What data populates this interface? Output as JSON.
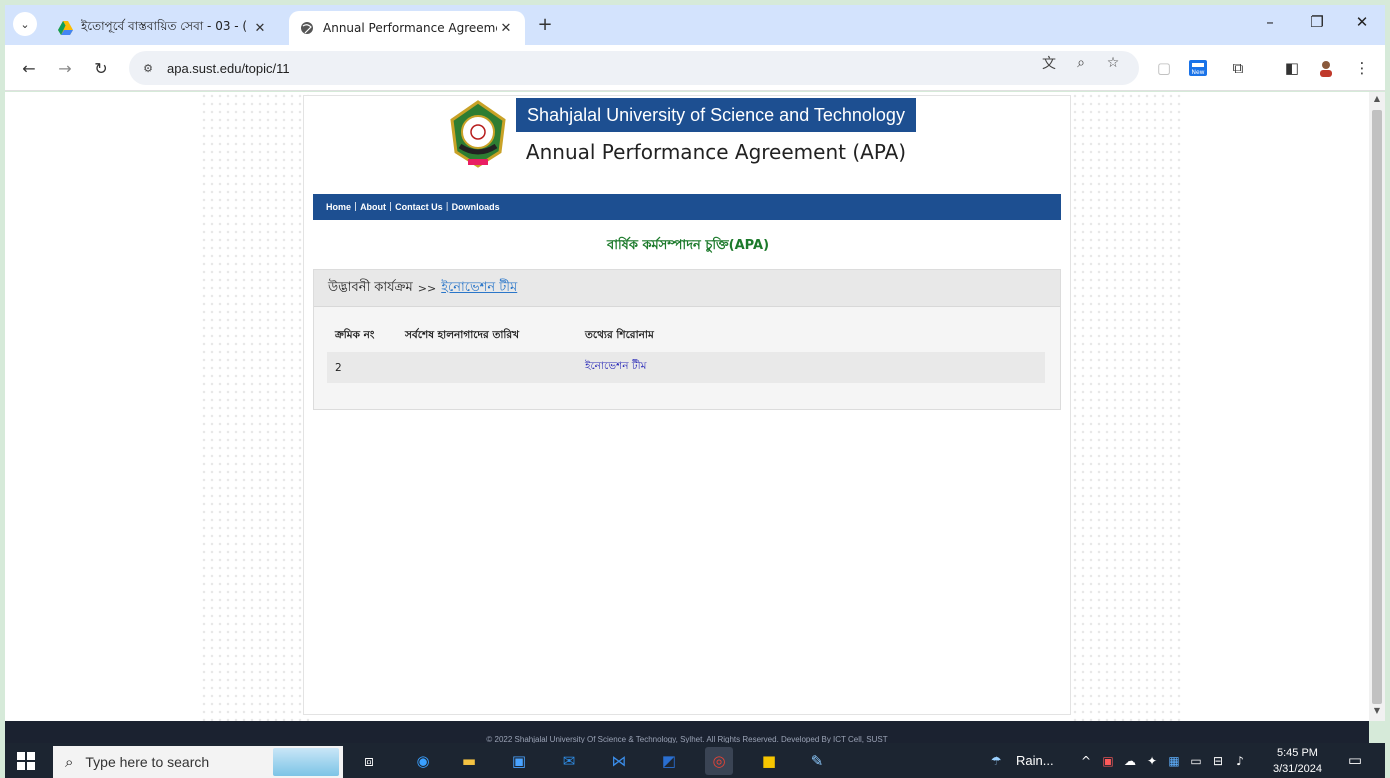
{
  "browser": {
    "tabs": [
      {
        "title": "ইতোপূর্বে বাস্তবায়িত সেবা - 03 - (",
        "active": false
      },
      {
        "title": "Annual Performance Agreemen",
        "active": true
      }
    ],
    "url": "apa.sust.edu/topic/11"
  },
  "site": {
    "university": "Shahjalal University of Science and Technology",
    "title": "Annual Performance Agreement (APA)",
    "nav": [
      "Home",
      "About",
      "Contact Us",
      "Downloads"
    ],
    "section_title": "বার্ষিক কর্মসম্পাদন চুক্তি(APA)"
  },
  "panel": {
    "crumb": "উদ্ভাবনী কার্যক্রম",
    "crumb_sep": ">>",
    "crumb_link": "ইনোভেশন টীম",
    "columns": [
      "ক্রমিক নং",
      "সর্বশেষ হালনাগাদের তারিখ",
      "তথ্যের শিরোনাম"
    ],
    "rows": [
      {
        "serial": "2",
        "date": "",
        "title": "ইনোভেশন টীম"
      }
    ]
  },
  "footer": {
    "text": "© 2022 Shahjalal University Of Science & Technology, Sylhet. All Rights Reserved. Developed By ICT Cell, SUST"
  },
  "taskbar": {
    "search_placeholder": "Type here to search",
    "weather": "Rain...",
    "time": "5:45 PM",
    "date": "3/31/2024"
  }
}
